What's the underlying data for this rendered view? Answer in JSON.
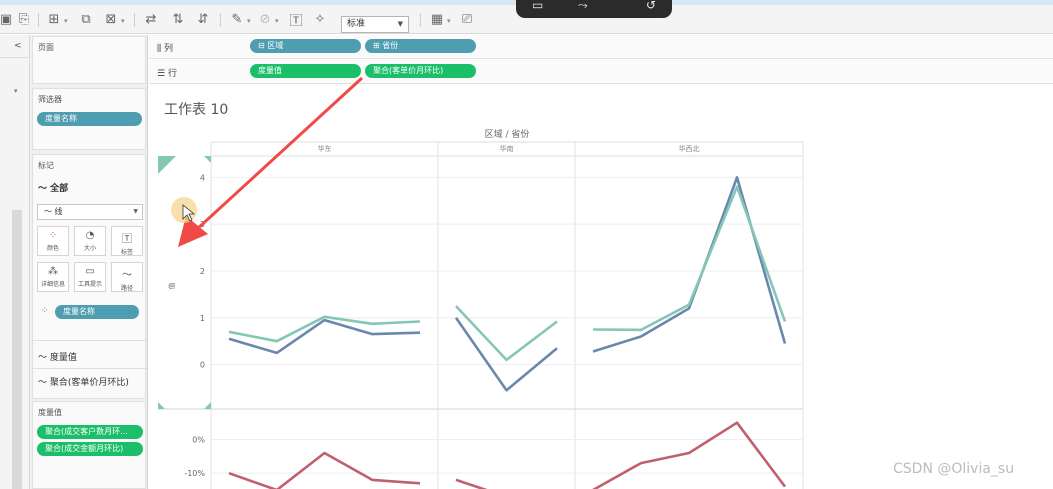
{
  "toolbar": {
    "format_combo": "标准"
  },
  "left_strip": {
    "collapse": "<"
  },
  "pages": {
    "title": "页面"
  },
  "filters": {
    "title": "筛选器",
    "pill": "度量名称"
  },
  "marks": {
    "title": "标记",
    "all_label": "全部",
    "mark_type": "线",
    "buttons": [
      "颜色",
      "大小",
      "标签",
      "详细信息",
      "工具提示",
      "路径"
    ],
    "color_pill": "度量名称",
    "sections": [
      "度量值",
      "聚合(客单价月环比)"
    ]
  },
  "measure_values": {
    "title": "度量值",
    "pills": [
      "聚合(成交客户数月环...",
      "聚合(成交金额月环比)"
    ]
  },
  "shelves": {
    "columns_label": "列",
    "rows_label": "行",
    "columns_pills": [
      "区域",
      "省份"
    ],
    "rows_pills": [
      "度量值",
      "聚合(客单价月环比)"
    ]
  },
  "sheet": {
    "title": "工作表 10"
  },
  "chart_data": {
    "type": "line",
    "header": "区域 / 省份",
    "panels": [
      "华东",
      "华南",
      "华西北"
    ],
    "top": {
      "y_ticks": [
        "0",
        "1",
        "2",
        "3",
        "4"
      ],
      "ylim": [
        -0.8,
        4.2
      ],
      "axis_label": "值",
      "series": [
        {
          "color": "#6a88ad",
          "panels": [
            [
              0.55,
              0.25,
              0.95,
              0.65,
              0.68
            ],
            [
              1.0,
              -0.55,
              0.35
            ],
            [
              0.28,
              0.6,
              1.2,
              4.0,
              0.45
            ]
          ]
        },
        {
          "color": "#84c7b6",
          "panels": [
            [
              0.7,
              0.5,
              1.02,
              0.87,
              0.92
            ],
            [
              1.25,
              0.1,
              0.92
            ],
            [
              0.75,
              0.74,
              1.28,
              3.8,
              0.92
            ]
          ]
        }
      ]
    },
    "bottom": {
      "y_ticks": [
        "0%",
        "-10%"
      ],
      "ylim": [
        -0.15,
        0.07
      ],
      "series": [
        {
          "color": "#c0606f",
          "panels": [
            [
              -0.1,
              -0.15,
              -0.04,
              -0.12,
              -0.13
            ],
            [
              -0.12,
              -0.17,
              -0.18
            ],
            [
              -0.15,
              -0.07,
              -0.04,
              0.05,
              -0.14
            ]
          ]
        }
      ]
    }
  },
  "watermark": "CSDN @Olivia_su"
}
